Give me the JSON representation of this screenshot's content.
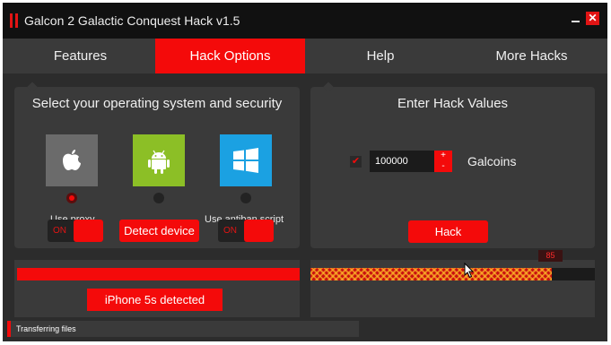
{
  "window": {
    "title": "Galcon 2 Galactic Conquest Hack v1.5",
    "minimize_label": "_",
    "close_label": "✕"
  },
  "tabs": [
    {
      "label": "Features",
      "active": false
    },
    {
      "label": "Hack Options",
      "active": true
    },
    {
      "label": "Help",
      "active": false
    },
    {
      "label": "More Hacks",
      "active": false
    }
  ],
  "os_panel": {
    "title": "Select your operating system and security",
    "os_options": [
      {
        "name": "apple-icon",
        "color": "#6b6b6b",
        "selected": true
      },
      {
        "name": "android-icon",
        "color": "#8cbf26",
        "selected": false
      },
      {
        "name": "windows-icon",
        "color": "#1ba1e2",
        "selected": false
      }
    ],
    "proxy": {
      "label": "Use proxy",
      "toggle_text": "ON"
    },
    "detect_button": "Detect device",
    "antiban": {
      "label": "Use antiban script",
      "toggle_text": "ON"
    }
  },
  "hack_panel": {
    "title": "Enter Hack Values",
    "checkbox_mark": "✔",
    "value": "100000",
    "plus": "+",
    "minus": "-",
    "resource_label": "Galcoins",
    "hack_button": "Hack"
  },
  "device_progress": {
    "fraction": 1.0
  },
  "device_status": "iPhone 5s detected",
  "hack_progress": {
    "percent": 85,
    "label": "85"
  },
  "status": {
    "text": "Transferring files"
  },
  "colors": {
    "accent": "#f40a0a",
    "panel": "#3a3a3a",
    "background": "#1e1e1e"
  }
}
